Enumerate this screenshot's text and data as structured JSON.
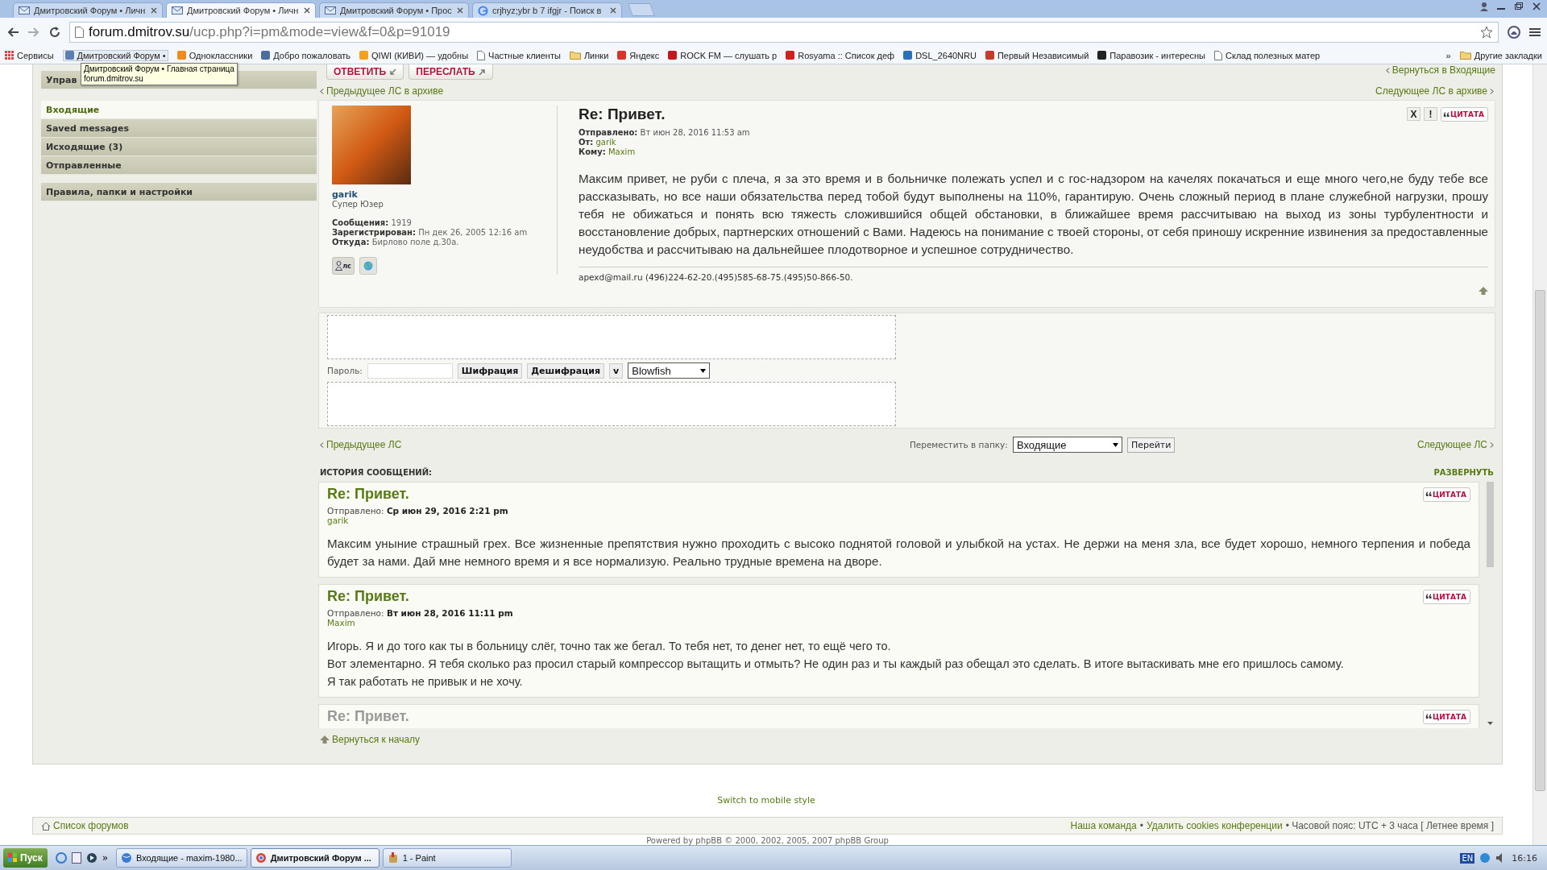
{
  "browser": {
    "tabs": [
      {
        "title": "Дмитровский Форум • Личн",
        "selected": false
      },
      {
        "title": "Дмитровский Форум • Личн",
        "selected": true
      },
      {
        "title": "Дмитровский Форум • Прос",
        "selected": false
      },
      {
        "title": "crjhyz;ybr b 7 ifgjr - Поиск в",
        "selected": false
      }
    ],
    "url": {
      "host": "forum.dmitrov.su",
      "path": "/ucp.php?i=pm&mode=view&f=0&p=91019"
    },
    "bookmarks": [
      {
        "label": "Сервисы",
        "kind": "apps"
      },
      {
        "label": "Дмитровский Форум •",
        "kind": "site",
        "color": "#5b7fb5"
      },
      {
        "label": "Одноклассники",
        "kind": "site",
        "color": "#f28a1a"
      },
      {
        "label": "Добро пожаловать",
        "kind": "site",
        "color": "#4a6f9e"
      },
      {
        "label": "QIWI (КИВИ) — удобны",
        "kind": "site",
        "color": "#f3a21c"
      },
      {
        "label": "Частные клиенты",
        "kind": "page"
      },
      {
        "label": "Линки",
        "kind": "folder"
      },
      {
        "label": "Яндекс",
        "kind": "site",
        "color": "#d8342a"
      },
      {
        "label": "ROCK FM — слушать р",
        "kind": "site",
        "color": "#c4161c"
      },
      {
        "label": "Rosyama :: Список деф",
        "kind": "site",
        "color": "#d01f1f"
      },
      {
        "label": "DSL_2640NRU",
        "kind": "site",
        "color": "#2a6fb8"
      },
      {
        "label": "Первый Независимый",
        "kind": "site",
        "color": "#c9382c"
      },
      {
        "label": "Паравозик - интересны",
        "kind": "site",
        "color": "#222222"
      },
      {
        "label": "Склад полезных матер",
        "kind": "page"
      }
    ],
    "bookmarks_more": "»",
    "other_bookmarks": "Другие закладки",
    "tooltip": {
      "title": "Дмитровский Форум • Главная страница",
      "url": "forum.dmitrov.su"
    }
  },
  "sidebar": {
    "header": "Управ",
    "folders": [
      {
        "label": "Входящие",
        "selected": true
      },
      {
        "label": "Saved messages",
        "selected": false
      },
      {
        "label": "Исходящие (3)",
        "selected": false
      },
      {
        "label": "Отправленные",
        "selected": false
      }
    ],
    "settings": {
      "label": "Правила, папки и настройки",
      "selected": false
    }
  },
  "toolbar": {
    "buttons": [
      {
        "label": "ОТВЕТИТЬ"
      },
      {
        "label": "ПЕРЕСЛАТЬ"
      }
    ],
    "back_link": "Вернуться в Входящие"
  },
  "archive_nav": {
    "prev": "Предыдущее ЛС в архиве",
    "next": "Следующее ЛС в архиве"
  },
  "post": {
    "author": {
      "name": "garik",
      "rank": "Супер Юзер",
      "stats": [
        {
          "label": "Сообщения:",
          "value": "1919"
        },
        {
          "label": "Зарегистрирован:",
          "value": "Пн дек 26, 2005 12:16 am"
        },
        {
          "label": "Откуда:",
          "value": "Бирлово поле д.30а."
        }
      ],
      "pm_button": "лс"
    },
    "title": "Re: Привет.",
    "meta": [
      {
        "label": "Отправлено:",
        "value": "Вт июн 28, 2016 11:53 am",
        "link": false
      },
      {
        "label": "От:",
        "value": "garik",
        "link": true
      },
      {
        "label": "Кому:",
        "value": "Maxim",
        "link": true
      }
    ],
    "actions": [
      "X",
      "!"
    ],
    "quote": "ЦИТАТА",
    "body": "Максим привет, не руби с плеча, я за это время и в больничке полежать успел и с гос-надзором на качелях покачаться и еще много чего,не буду тебе все рассказывать, но все наши обязательства перед тобой будут выполнены на 110%, гарантирую. Очень сложный период в плане служебной нагрузки, прошу тебя не обижаться и понять всю тяжесть сложившийся общей обстановки, в ближайшее время рассчитываю на выход из зоны турбулентности и восстановление добрых, партнерских отношений с Вами. Надеюсь на понимание с твоей стороны, от себя приношу искренние извинения за предоставленные неудобства и рассчитываю на дальнейшее плодотворное и успешное сотрудничество.",
    "signature": "apexd@mail.ru (496)224-62-20.(495)585-68-75.(495)50-866-50."
  },
  "crypto": {
    "password_label": "Пароль:",
    "buttons": [
      "Шифрация",
      "Дешифрация",
      "v"
    ],
    "algorithm": "Blowfish"
  },
  "pm_nav": {
    "prev": "Предыдущее ЛС",
    "move_label": "Переместить в папку:",
    "folder": "Входящие",
    "go": "Перейти",
    "next": "Следующее ЛС"
  },
  "history": {
    "title": "ИСТОРИЯ СООБЩЕНИЙ:",
    "expand": "РАЗВЕРНУТЬ",
    "messages": [
      {
        "title": "Re: Привет.",
        "sent_label": "Отправлено:",
        "date": "Ср июн 29, 2016 2:21 pm",
        "author": "garik",
        "quote": "ЦИТАТА",
        "faded": false,
        "lines": [
          "Максим уныние страшный грех. Все жизненные препятствия нужно проходить с высоко поднятой головой и улыбкой на устах. Не держи на меня зла, все будет хорошо, немного терпения и победа будет за нами. Дай мне немного время и я все нормализую. Реально трудные времена на дворе."
        ]
      },
      {
        "title": "Re: Привет.",
        "sent_label": "Отправлено:",
        "date": "Вт июн 28, 2016 11:11 pm",
        "author": "Maxim",
        "quote": "ЦИТАТА",
        "faded": false,
        "lines": [
          "Игорь. Я и до того как ты в больницу слёг, точно так же бегал. То тебя нет, то денег нет, то ещё чего то.",
          "Вот элементарно. Я тебя сколько раз просил старый компрессор вытащить и отмыть? Не один раз и ты каждый раз обещал это сделать. В итоге вытаскивать мне его пришлось самому.",
          "Я так работать не привык и не хочу."
        ]
      },
      {
        "title": "Re: Привет.",
        "quote": "ЦИТАТА",
        "faded": true
      }
    ]
  },
  "back_to_top": "Вернуться к началу",
  "mobile_link": "Switch to mobile style",
  "footer": {
    "index_link": "Список форумов",
    "right": [
      {
        "text": "Наша команда",
        "kind": "link"
      },
      {
        "text": "•",
        "kind": "sep"
      },
      {
        "text": "Удалить cookies конференции",
        "kind": "link"
      },
      {
        "text": "• Часовой пояс: UTC + 3 часа [ Летнее время ]",
        "kind": "text"
      }
    ],
    "powered": "Powered by phpBB © 2000, 2002, 2005, 2007 phpBB Group"
  },
  "taskbar": {
    "start": "Пуск",
    "more": "»",
    "tasks": [
      {
        "label": "Входящие - maxim-1980...",
        "selected": false
      },
      {
        "label": "Дмитровский Форум ...",
        "selected": true
      },
      {
        "label": "1 - Paint",
        "selected": false
      }
    ],
    "language": "EN",
    "clock": "16:16"
  }
}
